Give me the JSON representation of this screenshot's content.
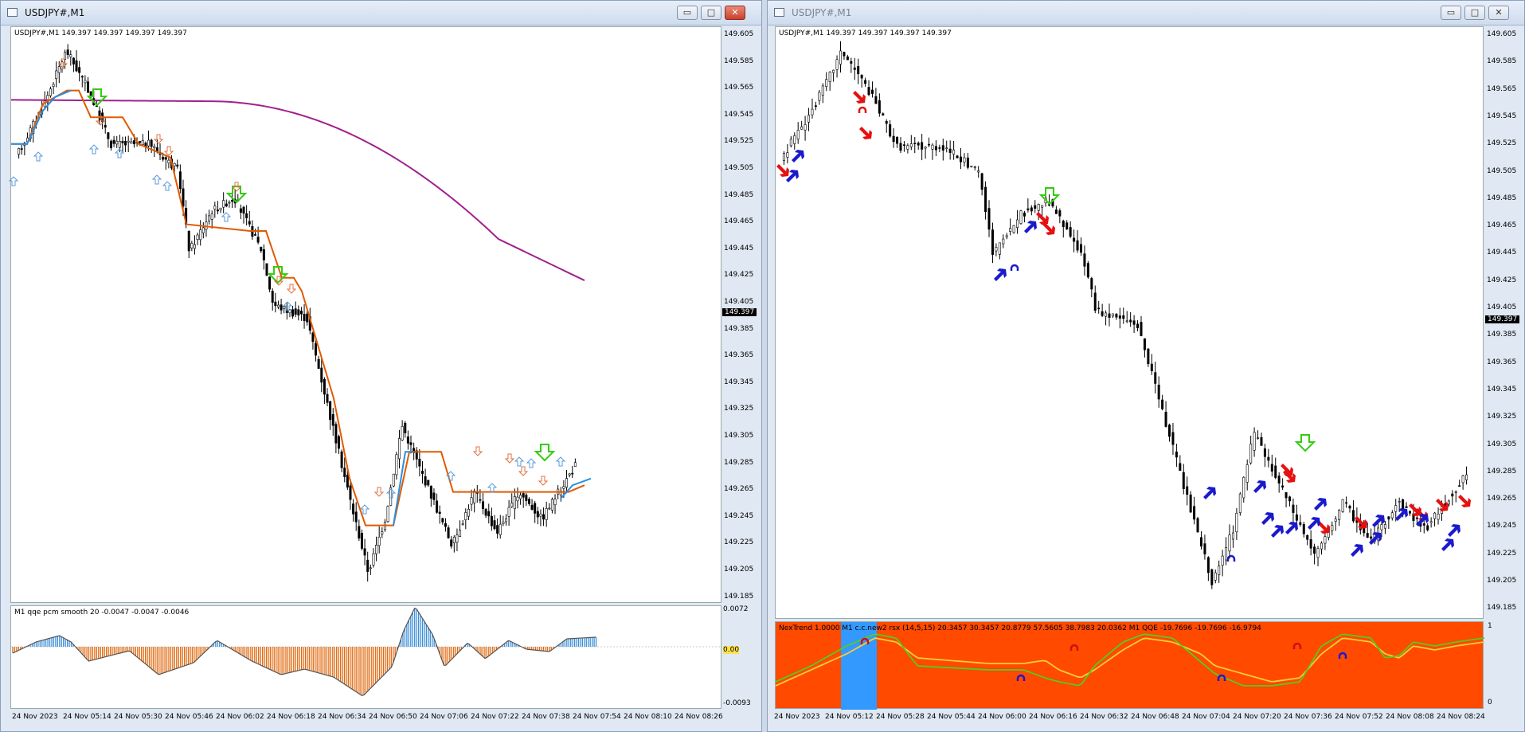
{
  "left_window": {
    "title": "USDJPY#,M1",
    "chart_header": "USDJPY#,M1  149.397 149.397 149.397 149.397",
    "price_axis": [
      "149.605",
      "149.585",
      "149.565",
      "149.545",
      "149.525",
      "149.505",
      "149.485",
      "149.465",
      "149.445",
      "149.425",
      "149.405",
      "149.385",
      "149.365",
      "149.345",
      "149.325",
      "149.305",
      "149.285",
      "149.265",
      "149.245",
      "149.225",
      "149.205",
      "149.185"
    ],
    "current_price": "149.397",
    "indicator_header": "M1  qqe pcm smooth  20 -0.0047 -0.0047 -0.0046",
    "indicator_axis": [
      "0.0072",
      "0.00",
      "-0.0093"
    ],
    "time_axis": [
      "24 Nov 2023",
      "24 Nov 05:14",
      "24 Nov 05:30",
      "24 Nov 05:46",
      "24 Nov 06:02",
      "24 Nov 06:18",
      "24 Nov 06:34",
      "24 Nov 06:50",
      "24 Nov 07:06",
      "24 Nov 07:22",
      "24 Nov 07:38",
      "24 Nov 07:54",
      "24 Nov 08:10",
      "24 Nov 08:26"
    ]
  },
  "right_window": {
    "title": "USDJPY#,M1",
    "chart_header": "USDJPY#,M1  149.397 149.397 149.397 149.397",
    "price_axis": [
      "149.605",
      "149.585",
      "149.565",
      "149.545",
      "149.525",
      "149.505",
      "149.485",
      "149.465",
      "149.445",
      "149.425",
      "149.405",
      "149.385",
      "149.365",
      "149.345",
      "149.325",
      "149.305",
      "149.285",
      "149.265",
      "149.245",
      "149.225",
      "149.205",
      "149.185"
    ],
    "current_price": "149.397",
    "indicator_header": "NexTrend  1.0000   M1 c.c.new2 rsx (14,5,15) 20.3457 30.3457 20.8779 57.5605 38.7983 20.0362   M1 QQE -19.7696 -19.7696 -16.9794",
    "indicator_axis": [
      "1",
      "0"
    ],
    "time_axis": [
      "24 Nov 2023",
      "24 Nov 05:12",
      "24 Nov 05:28",
      "24 Nov 05:44",
      "24 Nov 06:00",
      "24 Nov 06:16",
      "24 Nov 06:32",
      "24 Nov 06:48",
      "24 Nov 07:04",
      "24 Nov 07:20",
      "24 Nov 07:36",
      "24 Nov 07:52",
      "24 Nov 08:08",
      "24 Nov 08:24"
    ]
  },
  "window_buttons": {
    "minimize": "▭",
    "maximize": "□",
    "close": "✕"
  },
  "colors": {
    "trend_orange": "#e05a00",
    "trend_blue": "#2a8fe0",
    "ma_purple": "#a0218c",
    "signal_green": "#33cc11",
    "hist_blue": "#3d8fd8",
    "hist_orange": "#e06a10",
    "panel_orange": "#ff4a00",
    "panel_blue": "#3399ff",
    "arrow_red": "#e61010",
    "arrow_blue": "#1a1acc"
  }
}
